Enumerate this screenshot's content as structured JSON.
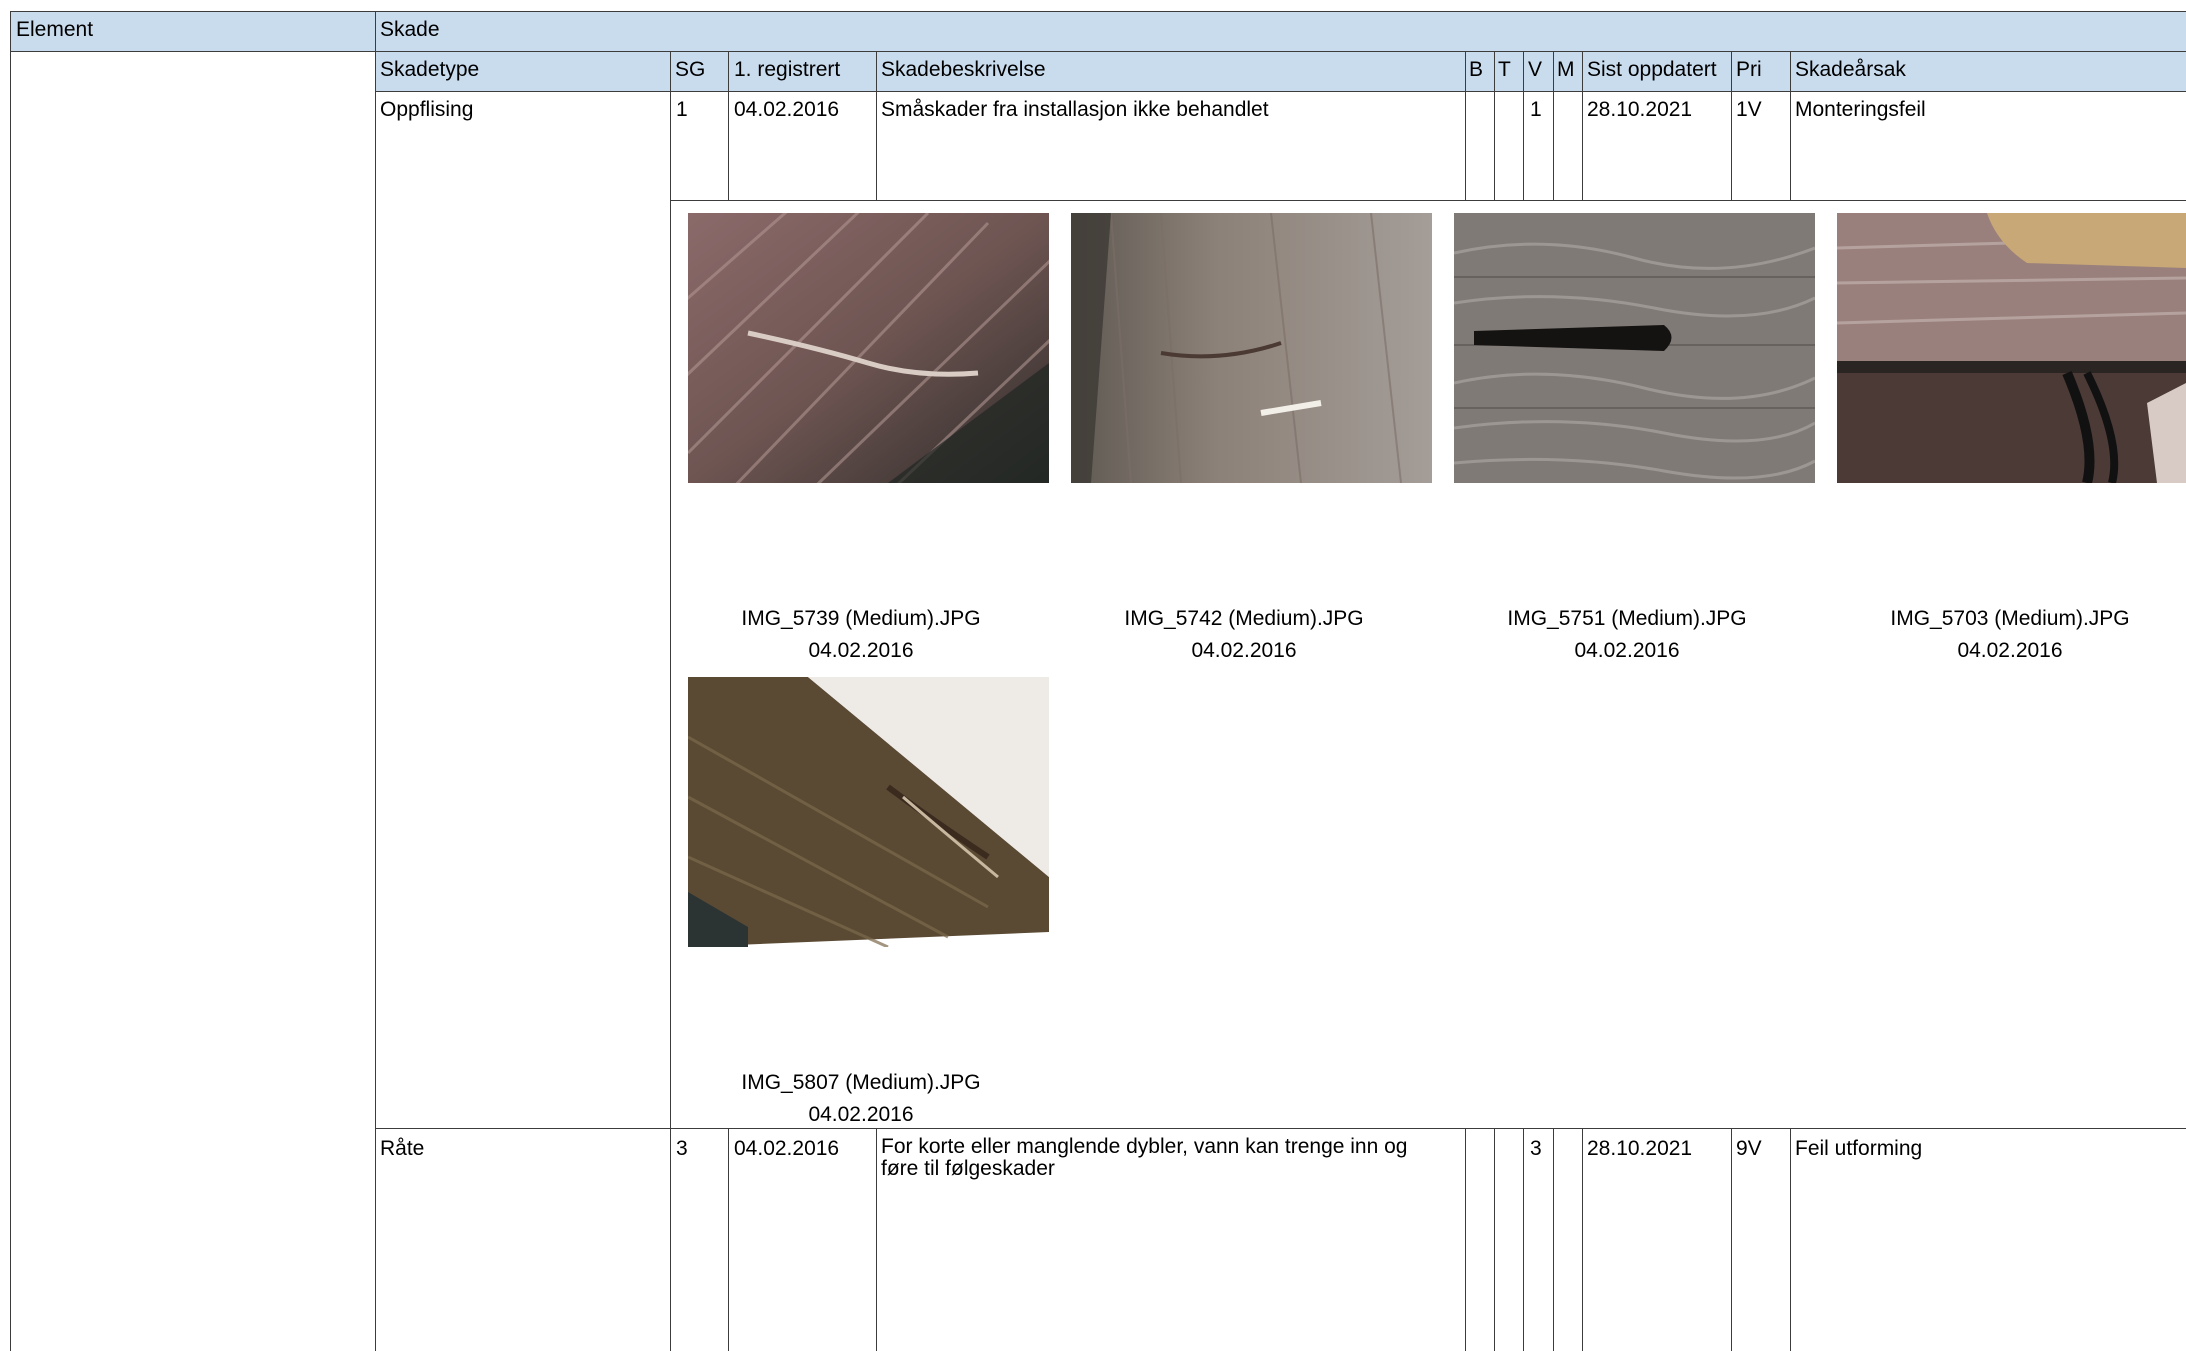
{
  "top_header": {
    "element": "Element",
    "skade": "Skade"
  },
  "columns": {
    "skadetype": "Skadetype",
    "sg": "SG",
    "registrert": "1. registrert",
    "beskrivelse": "Skadebeskrivelse",
    "b": "B",
    "t": "T",
    "v": "V",
    "m": "M",
    "oppdatert": "Sist oppdatert",
    "pri": "Pri",
    "arsak": "Skadeårsak"
  },
  "rows": [
    {
      "skadetype": "Oppflising",
      "sg": "1",
      "registrert": "04.02.2016",
      "beskrivelse": "Småskader fra installasjon ikke behandlet",
      "v": "1",
      "oppdatert": "28.10.2021",
      "pri": "1V",
      "arsak": "Monteringsfeil",
      "photos": [
        {
          "file": "IMG_5739 (Medium).JPG",
          "date": "04.02.2016"
        },
        {
          "file": "IMG_5742 (Medium).JPG",
          "date": "04.02.2016"
        },
        {
          "file": "IMG_5751 (Medium).JPG",
          "date": "04.02.2016"
        },
        {
          "file": "IMG_5703 (Medium).JPG",
          "date": "04.02.2016"
        },
        {
          "file": "IMG_5807 (Medium).JPG",
          "date": "04.02.2016"
        }
      ]
    },
    {
      "skadetype": "Råte",
      "sg": "3",
      "registrert": "04.02.2016",
      "beskrivelse": "For korte eller manglende dybler, vann kan trenge inn og føre til følgeskader",
      "v": "3",
      "oppdatert": "28.10.2021",
      "pri": "9V",
      "arsak": "Feil utforming"
    }
  ]
}
